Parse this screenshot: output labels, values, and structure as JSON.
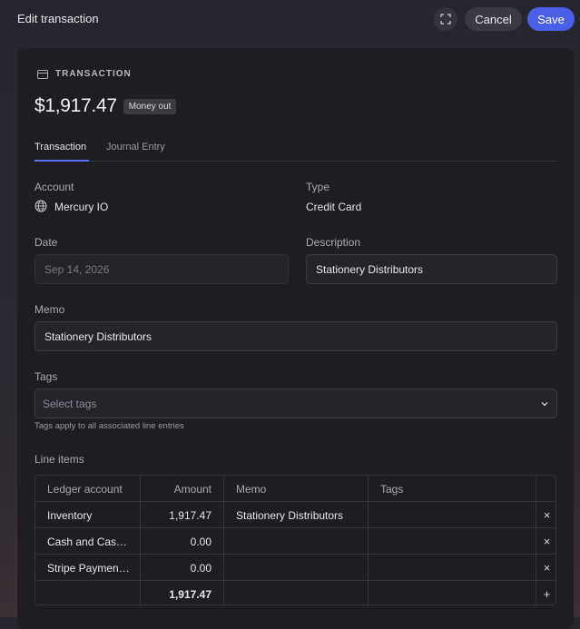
{
  "header": {
    "title": "Edit transaction",
    "cancel_label": "Cancel",
    "save_label": "Save"
  },
  "transaction": {
    "section_label": "TRANSACTION",
    "amount": "$1,917.47",
    "direction_badge": "Money out"
  },
  "tabs": [
    {
      "label": "Transaction",
      "active": true
    },
    {
      "label": "Journal Entry",
      "active": false
    }
  ],
  "fields": {
    "account_label": "Account",
    "account_value": "Mercury IO",
    "type_label": "Type",
    "type_value": "Credit Card",
    "date_label": "Date",
    "date_value": "Sep 14, 2026",
    "description_label": "Description",
    "description_value": "Stationery Distributors",
    "memo_label": "Memo",
    "memo_value": "Stationery Distributors",
    "tags_label": "Tags",
    "tags_placeholder": "Select tags",
    "tags_hint": "Tags apply to all associated line entries"
  },
  "line_items": {
    "title": "Line items",
    "columns": [
      "Ledger account",
      "Amount",
      "Memo",
      "Tags"
    ],
    "rows": [
      {
        "account": "Inventory",
        "amount": "1,917.47",
        "memo": "Stationery Distributors",
        "tags": ""
      },
      {
        "account": "Cash and Cas…",
        "amount": "0.00",
        "memo": "",
        "tags": ""
      },
      {
        "account": "Stripe Paymen…",
        "amount": "0.00",
        "memo": "",
        "tags": ""
      }
    ],
    "total": "1,917.47",
    "remove_symbol": "×",
    "add_symbol": "+"
  },
  "icons": {
    "expand": "expand-icon",
    "transaction": "card-icon",
    "account": "globe-icon",
    "chevron": "chevron-down-icon"
  },
  "colors": {
    "accent": "#4a5fe8",
    "panel": "#1d1d22",
    "tab_underline": "#5b6ff0"
  }
}
